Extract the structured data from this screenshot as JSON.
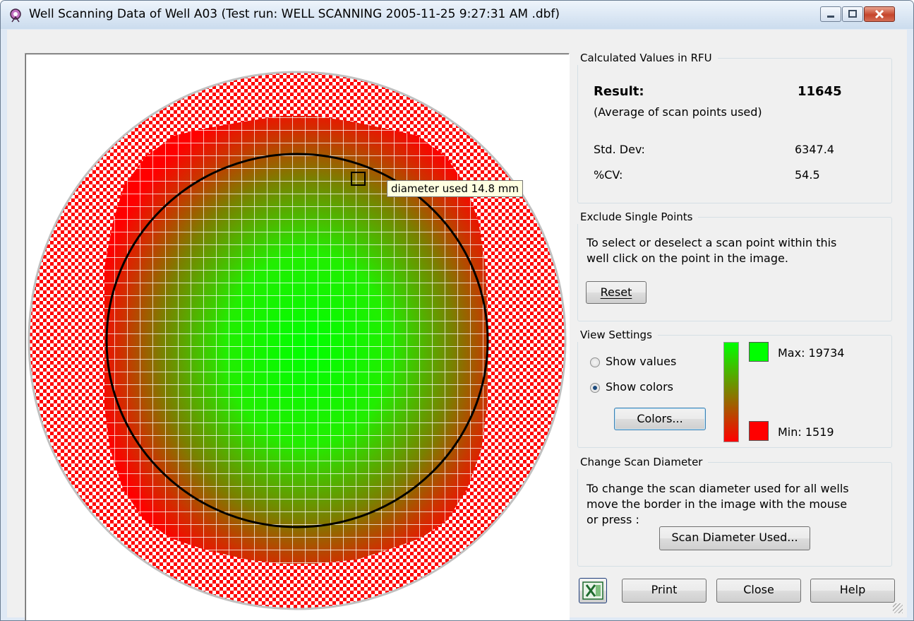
{
  "window": {
    "title": "Well Scanning Data of Well A03 (Test run: WELL SCANNING 2005-11-25 9:27:31 AM .dbf)",
    "icons": {
      "app": "well-scan-app-icon",
      "minimize": "minimize-icon",
      "maximize": "maximize-icon",
      "close": "close-icon"
    }
  },
  "image": {
    "tooltip": "diameter used 14.8 mm",
    "colors": {
      "min": "#ff0000",
      "max": "#00ff00",
      "grid": "#ffffff",
      "circle": "#000000",
      "outer_ring": "#c0c0c0"
    }
  },
  "calculated": {
    "legend": "Calculated Values in RFU",
    "result_label": "Result:",
    "result_value": "11645",
    "result_note": "(Average of scan points used)",
    "std_label": "Std. Dev:",
    "std_value": "6347.4",
    "cv_label": "%CV:",
    "cv_value": "54.5"
  },
  "exclude": {
    "legend": "Exclude Single Points",
    "text1": "To select or deselect a scan point within this",
    "text2": "well click on the point in the image.",
    "reset_label": "Reset"
  },
  "view": {
    "legend": "View Settings",
    "show_values": "Show values",
    "show_colors": "Show colors",
    "selected": "Show colors",
    "colors_button": "Colors...",
    "max_label": "Max: 19734",
    "min_label": "Min:  1519",
    "max_color": "#00ff00",
    "min_color": "#ff0000"
  },
  "diameter": {
    "legend": "Change Scan Diameter",
    "text1": "To change the scan diameter used for all wells",
    "text2": "move the border in the image with the mouse",
    "text3": "or press :",
    "button": "Scan Diameter Used..."
  },
  "footer": {
    "excel_icon": "excel-export-icon",
    "print": "Print",
    "close": "Close",
    "help": "Help"
  }
}
